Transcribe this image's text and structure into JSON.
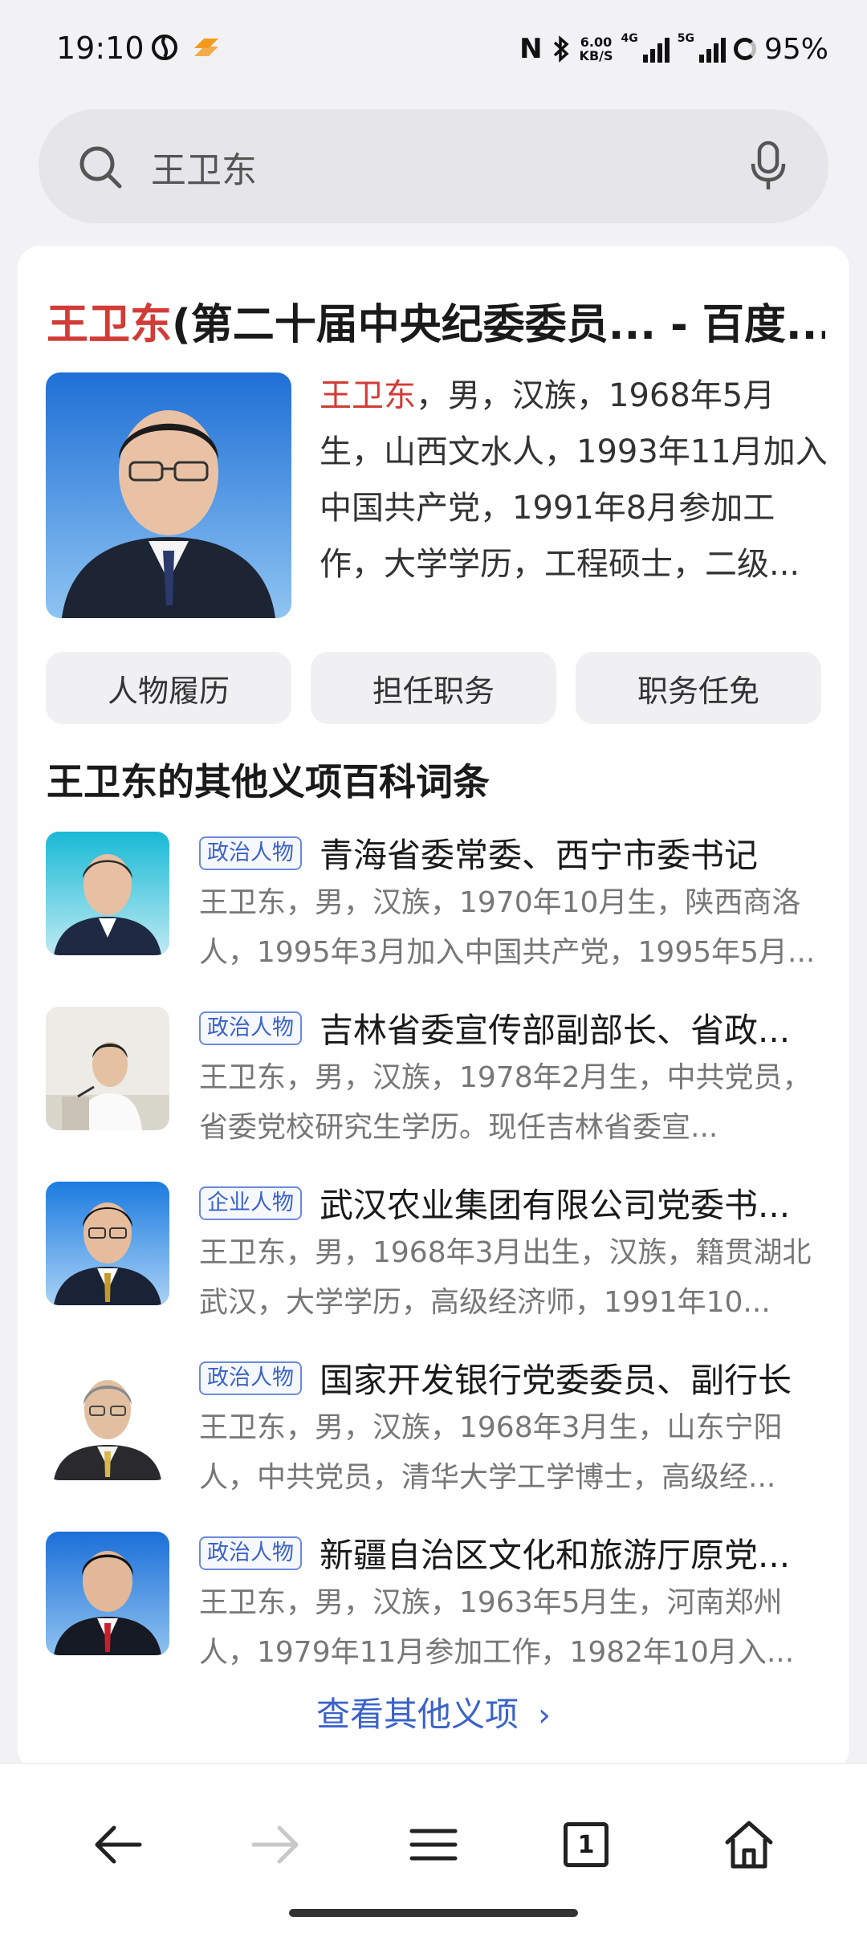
{
  "status_bar": {
    "time": "19:10",
    "net_speed_top": "6.00",
    "net_speed_unit": "KB/S",
    "sim1_label": "4G",
    "sim2_label": "5G",
    "battery": "95%",
    "icons": [
      "app-icon-1",
      "app-icon-2",
      "nfc-icon",
      "bluetooth-icon",
      "signal-icon",
      "battery-icon"
    ]
  },
  "search": {
    "query": "王卫东",
    "icons": [
      "search-icon",
      "microphone-icon"
    ]
  },
  "result": {
    "title_highlight": "王卫东",
    "title_rest": "(第二十届中央纪委委员... - 百度...",
    "summary_highlight": "王卫东",
    "summary_rest": "，男，汉族，1968年5月生，山西文水人，1993年11月加入中国共产党，1991年8月参加工作，大学学历，工程硕士，二级...",
    "chips": [
      "人物履历",
      "担任职务",
      "职务任免"
    ]
  },
  "other_entries": {
    "section_title": "王卫东的其他义项百科词条",
    "items": [
      {
        "tag": "政治人物",
        "title": "青海省委常委、西宁市委书记",
        "desc": "王卫东，男，汉族，1970年10月生，陕西商洛人，1995年3月加入中国共产党，1995年5月..."
      },
      {
        "tag": "政治人物",
        "title": "吉林省委宣传部副部长、省政...",
        "desc": "王卫东，男，汉族，1978年2月生，中共党员，省委党校研究生学历。现任吉林省委宣..."
      },
      {
        "tag": "企业人物",
        "title": "武汉农业集团有限公司党委书...",
        "desc": "王卫东，男，1968年3月出生，汉族，籍贯湖北武汉，大学学历，高级经济师，1991年10..."
      },
      {
        "tag": "政治人物",
        "title": "国家开发银行党委委员、副行长",
        "desc": "王卫东，男，汉族，1968年3月生，山东宁阳人，中共党员，清华大学工学博士，高级经..."
      },
      {
        "tag": "政治人物",
        "title": "新疆自治区文化和旅游厅原党...",
        "desc": "王卫东，男，汉族，1963年5月生，河南郑州人，1979年11月参加工作，1982年10月入..."
      }
    ],
    "more_label": "查看其他义项"
  },
  "bottom_nav": {
    "tab_count": "1",
    "icons": [
      "back-arrow-icon",
      "forward-arrow-icon",
      "menu-icon",
      "tabs-icon",
      "home-icon"
    ]
  },
  "colors": {
    "highlight_red": "#d23b36",
    "link_blue": "#3b63c8",
    "background": "#f2f2f5"
  }
}
